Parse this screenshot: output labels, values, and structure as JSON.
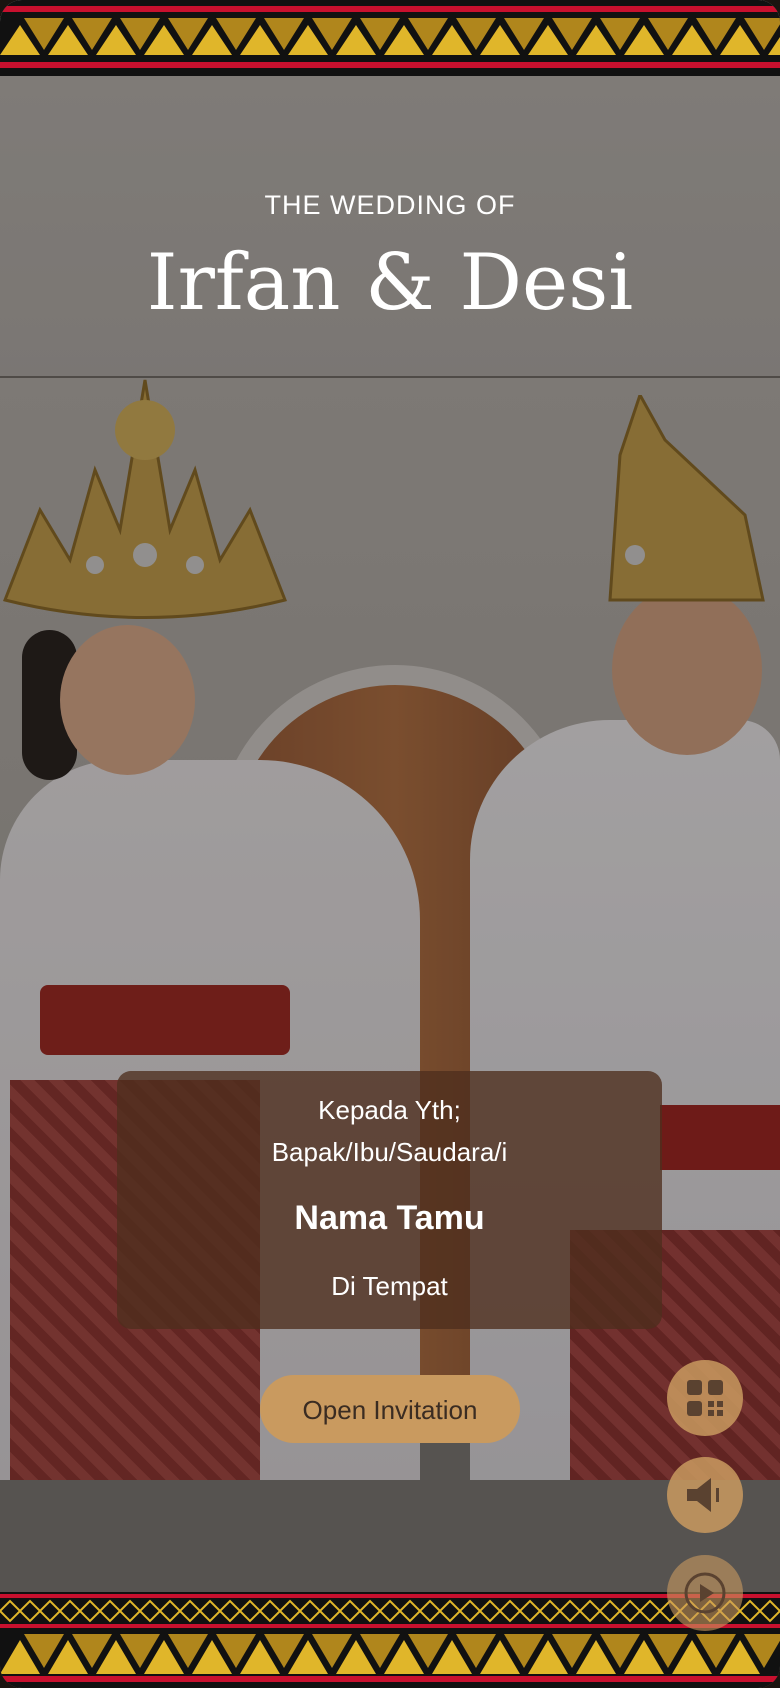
{
  "header": {
    "subtitle": "THE WEDDING OF",
    "couple": "Irfan & Desi"
  },
  "invitation": {
    "greeting_line1": "Kepada Yth;",
    "greeting_line2": "Bapak/Ibu/Saudara/i",
    "guest_name": "Nama Tamu",
    "location_line": "Di Tempat",
    "open_button": "Open Invitation"
  },
  "floating_controls": {
    "qr_icon": "qr-code-icon",
    "sound_icon": "speaker-icon",
    "play_icon": "play-icon"
  },
  "colors": {
    "accent": "#c99a5f",
    "card_bg": "#4e2e1e",
    "border_red": "#c8102e",
    "border_gold": "#e0b62a"
  }
}
